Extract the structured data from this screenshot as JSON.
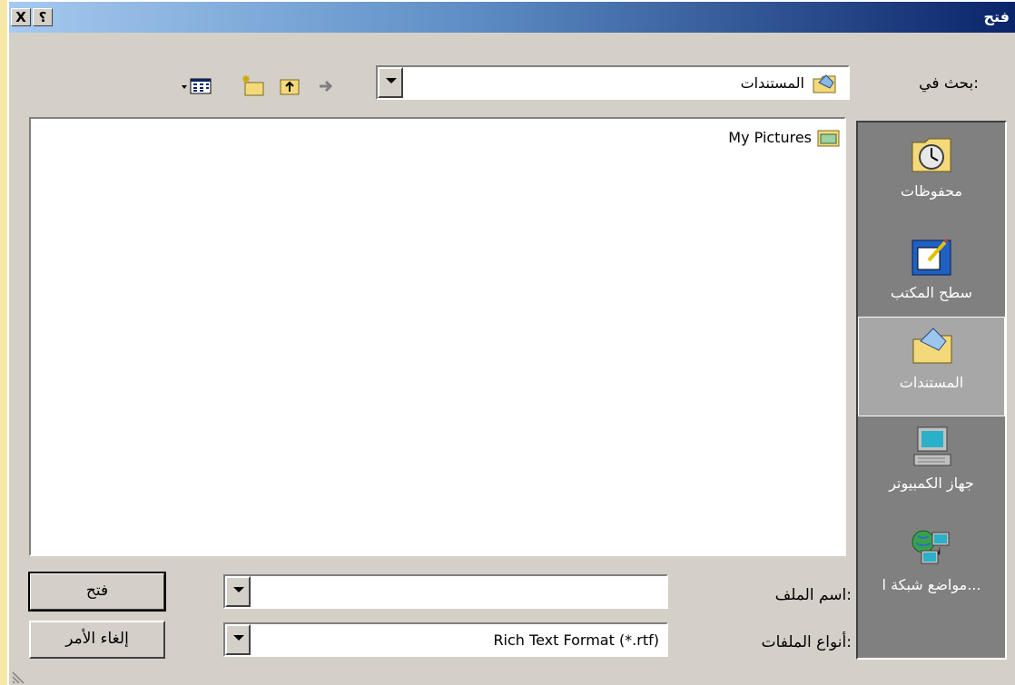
{
  "window": {
    "title": "فتح",
    "help_glyph": "؟",
    "close_glyph": "X"
  },
  "look_in": {
    "label": "بحث في:",
    "value": "المستندات"
  },
  "toolbar": {
    "back": "back-arrow-icon",
    "up": "up-folder-icon",
    "new_folder": "new-folder-icon",
    "views": "views-icon"
  },
  "files": [
    {
      "name": "My Pictures"
    }
  ],
  "places": [
    {
      "label": "محفوظات",
      "icon": "history-icon"
    },
    {
      "label": "سطح المكتب",
      "icon": "desktop-icon"
    },
    {
      "label": "المستندات",
      "icon": "my-documents-icon",
      "selected": true
    },
    {
      "label": "جهاز الكمبيوتر",
      "icon": "my-computer-icon"
    },
    {
      "label": "مواضع شبكة ا...",
      "icon": "network-places-icon"
    }
  ],
  "filename": {
    "label": "اسم الملف:",
    "value": ""
  },
  "filetype": {
    "label": "أنواع الملفات:",
    "value": "Rich Text Format (*.rtf)"
  },
  "buttons": {
    "open": "فتح",
    "cancel": "إلغاء الأمر"
  },
  "colors": {
    "title_start": "#a6caf0",
    "title_end": "#0a246a",
    "face": "#d4d0c8",
    "places_bg": "#808080"
  }
}
